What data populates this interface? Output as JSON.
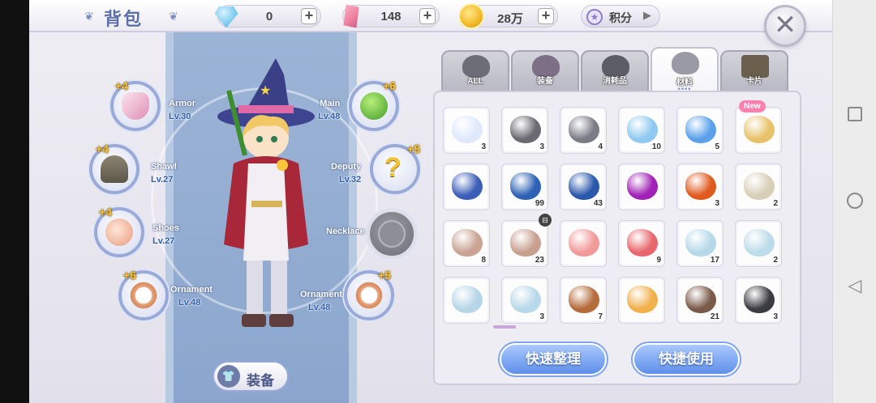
{
  "header": {
    "title": "背包",
    "currencies": [
      {
        "name": "diamond",
        "icon": "diamond-icon",
        "value": "0"
      },
      {
        "name": "crystal",
        "icon": "crystal-icon",
        "value": "148"
      },
      {
        "name": "gold",
        "icon": "gold-coin-icon",
        "value": "28万"
      }
    ],
    "plus_label": "+",
    "points_label": "积分",
    "close_label": "✕"
  },
  "equipment": {
    "slots": [
      {
        "key": "armor",
        "name": "Armor",
        "level": "Lv.30",
        "bonus": "+4",
        "icon": "armor-icon"
      },
      {
        "key": "main",
        "name": "Main",
        "level": "Lv.48",
        "bonus": "+6",
        "icon": "staff-icon"
      },
      {
        "key": "shawl",
        "name": "Shawl",
        "level": "Lv.27",
        "bonus": "+4",
        "icon": "shawl-icon"
      },
      {
        "key": "deputy",
        "name": "Deputy",
        "level": "Lv.32",
        "bonus": "+5",
        "icon": "mystery-icon"
      },
      {
        "key": "shoes",
        "name": "Shoes",
        "level": "Lv.27",
        "bonus": "+4",
        "icon": "shoes-icon"
      },
      {
        "key": "necklace",
        "name": "Necklace",
        "level": "",
        "bonus": "",
        "icon": "empty-slot-icon"
      },
      {
        "key": "ornament_l",
        "name": "Ornament",
        "level": "Lv.48",
        "bonus": "+6",
        "icon": "ring-icon"
      },
      {
        "key": "ornament_r",
        "name": "Ornament",
        "level": "Lv.48",
        "bonus": "+5",
        "icon": "ring-icon"
      }
    ],
    "equip_button": "装备"
  },
  "inventory": {
    "tabs": [
      {
        "label": "ALL",
        "icon": "all-icon",
        "active": false
      },
      {
        "label": "装备",
        "icon": "equipment-icon",
        "active": false
      },
      {
        "label": "消耗品",
        "icon": "consumable-icon",
        "active": false
      },
      {
        "label": "材料",
        "icon": "material-icon",
        "active": true
      },
      {
        "label": "卡片",
        "icon": "card-icon",
        "active": false
      }
    ],
    "active_dots": "••••",
    "new_tag": "New",
    "items": [
      {
        "icon": "white-gem-icon",
        "count": "3",
        "color": "#dfe9fb"
      },
      {
        "icon": "moon-stone-icon",
        "count": "3",
        "color": "#6b6a72"
      },
      {
        "icon": "dark-ore-icon",
        "count": "4",
        "color": "#7b7d86"
      },
      {
        "icon": "ice-crystal-icon",
        "count": "10",
        "color": "#8fc9f2"
      },
      {
        "icon": "blue-crystal-icon",
        "count": "5",
        "color": "#5aa0ea"
      },
      {
        "icon": "rainbow-scale-icon",
        "count": "",
        "color": "#e8c26a",
        "new": true
      },
      {
        "icon": "galaxy-gem-icon",
        "count": "",
        "color": "#3b5fb8"
      },
      {
        "icon": "blue-bean-icon",
        "count": "99",
        "color": "#2e62b5"
      },
      {
        "icon": "blue-bean-icon",
        "count": "43",
        "color": "#2a58ac"
      },
      {
        "icon": "purple-bean-icon",
        "count": "",
        "color": "#a021b5"
      },
      {
        "icon": "orange-bean-icon",
        "count": "3",
        "color": "#e05a1e"
      },
      {
        "icon": "treasure-chest-icon",
        "count": "2",
        "color": "#d8cfb9"
      },
      {
        "icon": "bronze-coin-icon",
        "count": "8",
        "color": "#caa392"
      },
      {
        "icon": "bronze-coin-icon",
        "count": "23",
        "color": "#c9a090"
      },
      {
        "icon": "pink-ore-icon",
        "count": "",
        "color": "#f29a9a"
      },
      {
        "icon": "red-crystal-icon",
        "count": "9",
        "color": "#e8676d"
      },
      {
        "icon": "frost-shard-icon",
        "count": "17",
        "color": "#b6d9ea"
      },
      {
        "icon": "frost-shard-icon",
        "count": "2",
        "color": "#bcdcea"
      },
      {
        "icon": "frost-shard-icon",
        "count": "",
        "color": "#b6d6e8"
      },
      {
        "icon": "frost-shard-icon",
        "count": "3",
        "color": "#b8d9ea"
      },
      {
        "icon": "bark-icon",
        "count": "7",
        "color": "#b66b3b"
      },
      {
        "icon": "honeycomb-icon",
        "count": "",
        "color": "#f0b04a"
      },
      {
        "icon": "beast-claw-icon",
        "count": "21",
        "color": "#7a5a48"
      },
      {
        "icon": "black-shell-icon",
        "count": "3",
        "color": "#3b3b42"
      }
    ],
    "sort_button": "快速整理",
    "quick_use_button": "快捷使用"
  },
  "system_nav": {
    "recent_icon": "square-icon",
    "home_icon": "circle-icon",
    "back_icon": "triangle-back-icon"
  }
}
